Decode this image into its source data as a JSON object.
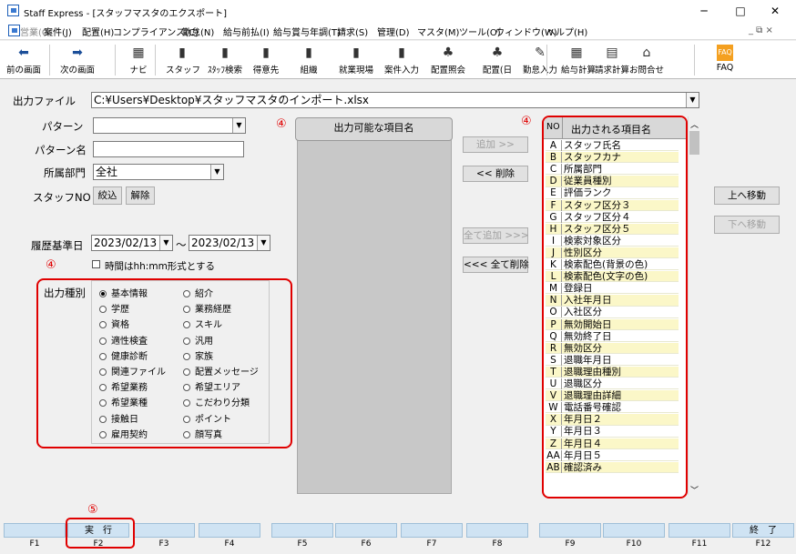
{
  "window": {
    "title": "Staff Express - [スタッフマスタのエクスポート]",
    "min": "─",
    "max": "□",
    "close": "✕"
  },
  "menubar": {
    "items": [
      {
        "label": "営業(G)",
        "disabled": true
      },
      {
        "label": "案件(J)"
      },
      {
        "label": "配置(H)"
      },
      {
        "label": "コンプライアンス(C)"
      },
      {
        "label": "勤怠(N)"
      },
      {
        "label": "給与前払(I)"
      },
      {
        "label": "給与賞与年調(T)"
      },
      {
        "label": "請求(S)"
      },
      {
        "label": "管理(D)"
      },
      {
        "label": "マスタ(M)"
      },
      {
        "label": "ツール(O)"
      },
      {
        "label": "ウィンドウ(W)"
      },
      {
        "label": "ヘルプ(H)"
      }
    ],
    "mdi": "_ ⧉ ×"
  },
  "toolbar": {
    "buttons": [
      {
        "label": "前の画面",
        "icon": "back-arrow-icon"
      },
      {
        "label": "次の画面",
        "icon": "forward-arrow-icon"
      },
      {
        "label": "ナビ",
        "icon": "navi-icon"
      },
      {
        "label": "スタッフ",
        "icon": "staff-icon"
      },
      {
        "label": "ｽﾀｯﾌ検索",
        "icon": "staff-search-icon"
      },
      {
        "label": "得意先",
        "icon": "customer-icon"
      },
      {
        "label": "組織",
        "icon": "organization-icon"
      },
      {
        "label": "就業現場",
        "icon": "worksite-icon"
      },
      {
        "label": "案件入力",
        "icon": "job-entry-icon"
      },
      {
        "label": "配置照会",
        "icon": "placement-inquiry-icon"
      },
      {
        "label": "配置(日",
        "icon": "placement-day-icon"
      },
      {
        "label": "勤怠入力",
        "icon": "attendance-icon"
      },
      {
        "label": "給与計算",
        "icon": "payroll-icon"
      },
      {
        "label": "請求計算",
        "icon": "billing-icon"
      },
      {
        "label": "お問合せ",
        "icon": "inquiry-icon"
      },
      {
        "label": "FAQ",
        "icon": "faq-icon"
      }
    ]
  },
  "form": {
    "output_file_label": "出力ファイル",
    "output_file_value": "C:¥Users¥Desktop¥スタッフマスタのインポート.xlsx",
    "pattern_label": "パターン",
    "pattern_value": "",
    "pattern_name_label": "パターン名",
    "pattern_name_value": "",
    "dept_label": "所属部門",
    "dept_value": "全社",
    "staff_no_label": "スタッフNO",
    "filter_btn": "絞込",
    "clear_btn": "解除",
    "history_label": "履歴基準日",
    "date_from": "2023/02/13",
    "tilde": "～",
    "date_to": "2023/02/13",
    "time_format_label": "時間はhh:mm形式とする"
  },
  "output_type": {
    "label": "出力種別",
    "options": [
      {
        "label": "基本情報",
        "selected": true
      },
      {
        "label": "紹介"
      },
      {
        "label": "学歴"
      },
      {
        "label": "業務経歴"
      },
      {
        "label": "資格"
      },
      {
        "label": "スキル"
      },
      {
        "label": "適性検査"
      },
      {
        "label": "汎用"
      },
      {
        "label": "健康診断"
      },
      {
        "label": "家族"
      },
      {
        "label": "関連ファイル"
      },
      {
        "label": "配置メッセージ"
      },
      {
        "label": "希望業務"
      },
      {
        "label": "希望エリア"
      },
      {
        "label": "希望業種"
      },
      {
        "label": "こだわり分類"
      },
      {
        "label": "接触日"
      },
      {
        "label": "ポイント"
      },
      {
        "label": "雇用契約"
      },
      {
        "label": "顔写真"
      }
    ]
  },
  "available": {
    "header": "出力可能な項目名"
  },
  "mid_buttons": {
    "add": "追加 >>",
    "remove": "<< 削除",
    "add_all": "全て追加 >>>",
    "remove_all": "<<< 全て削除"
  },
  "output": {
    "no_header": "NO",
    "name_header": "出力される項目名",
    "rows": [
      {
        "k": "A",
        "v": "スタッフ氏名"
      },
      {
        "k": "B",
        "v": "スタッフカナ"
      },
      {
        "k": "C",
        "v": "所属部門"
      },
      {
        "k": "D",
        "v": "従業員種別"
      },
      {
        "k": "E",
        "v": "評価ランク"
      },
      {
        "k": "F",
        "v": "スタッフ区分３"
      },
      {
        "k": "G",
        "v": "スタッフ区分４"
      },
      {
        "k": "H",
        "v": "スタッフ区分５"
      },
      {
        "k": "I",
        "v": "検索対象区分"
      },
      {
        "k": "J",
        "v": "性別区分"
      },
      {
        "k": "K",
        "v": "検索配色(背景の色)"
      },
      {
        "k": "L",
        "v": "検索配色(文字の色)"
      },
      {
        "k": "M",
        "v": "登録日"
      },
      {
        "k": "N",
        "v": "入社年月日"
      },
      {
        "k": "O",
        "v": "入社区分"
      },
      {
        "k": "P",
        "v": "無効開始日"
      },
      {
        "k": "Q",
        "v": "無効終了日"
      },
      {
        "k": "R",
        "v": "無効区分"
      },
      {
        "k": "S",
        "v": "退職年月日"
      },
      {
        "k": "T",
        "v": "退職理由種別"
      },
      {
        "k": "U",
        "v": "退職区分"
      },
      {
        "k": "V",
        "v": "退職理由詳細"
      },
      {
        "k": "W",
        "v": "電話番号確認"
      },
      {
        "k": "X",
        "v": "年月日２"
      },
      {
        "k": "Y",
        "v": "年月日３"
      },
      {
        "k": "Z",
        "v": "年月日４"
      },
      {
        "k": "AA",
        "v": "年月日５"
      },
      {
        "k": "AB",
        "v": "確認済み"
      }
    ]
  },
  "side_buttons": {
    "up": "上へ移動",
    "down": "下へ移動"
  },
  "annotations": {
    "n4a": "④",
    "n4b": "④",
    "n4c": "④",
    "n5": "⑤"
  },
  "fkeys": [
    {
      "label": "",
      "key": "F1"
    },
    {
      "label": "実　行",
      "key": "F2"
    },
    {
      "label": "",
      "key": "F3"
    },
    {
      "label": "",
      "key": "F4"
    },
    {
      "label": "",
      "key": "F5"
    },
    {
      "label": "",
      "key": "F6"
    },
    {
      "label": "",
      "key": "F7"
    },
    {
      "label": "",
      "key": "F8"
    },
    {
      "label": "",
      "key": "F9"
    },
    {
      "label": "",
      "key": "F10"
    },
    {
      "label": "",
      "key": "F11"
    },
    {
      "label": "終　了",
      "key": "F12"
    }
  ]
}
